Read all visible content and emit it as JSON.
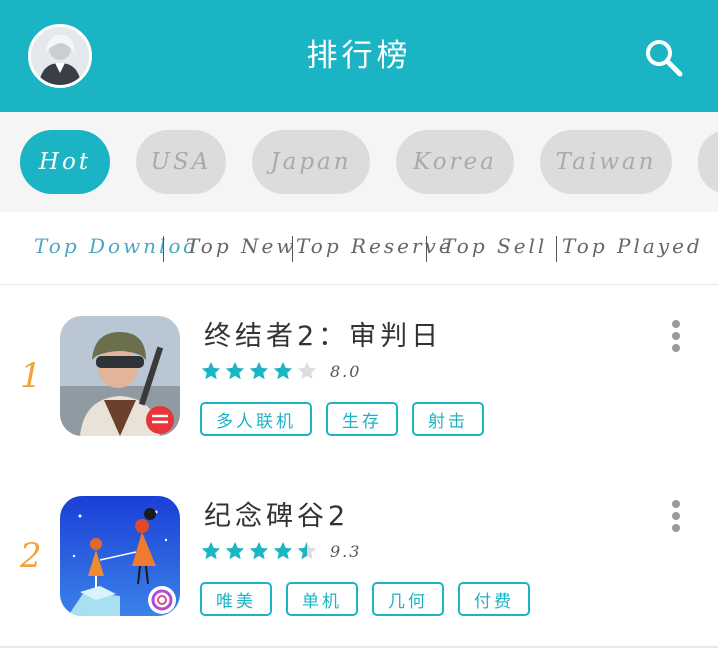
{
  "header": {
    "title": "排行榜",
    "accent_color": "#1bb4c4",
    "avatar_icon": "user-avatar",
    "search_icon": "search-icon"
  },
  "regions": [
    {
      "label": "Hot",
      "active": true
    },
    {
      "label": "USA",
      "active": false
    },
    {
      "label": "Japan",
      "active": false
    },
    {
      "label": "Korea",
      "active": false
    },
    {
      "label": "Taiwan",
      "active": false
    }
  ],
  "subtabs": [
    {
      "label": "Top Downlod",
      "active": true
    },
    {
      "label": "Top New",
      "active": false
    },
    {
      "label": "Top Reserve",
      "active": false
    },
    {
      "label": "Top Sell",
      "active": false
    },
    {
      "label": "Top Played",
      "active": false
    }
  ],
  "apps": [
    {
      "rank": "1",
      "name": "终结者2：审判日",
      "rating_text": "8.0",
      "rating_stars": 4,
      "tags": [
        "多人联机",
        "生存",
        "射击"
      ]
    },
    {
      "rank": "2",
      "name": "纪念碑谷2",
      "rating_text": "9.3",
      "rating_stars": 4.5,
      "tags": [
        "唯美",
        "单机",
        "几何",
        "付费"
      ]
    }
  ]
}
